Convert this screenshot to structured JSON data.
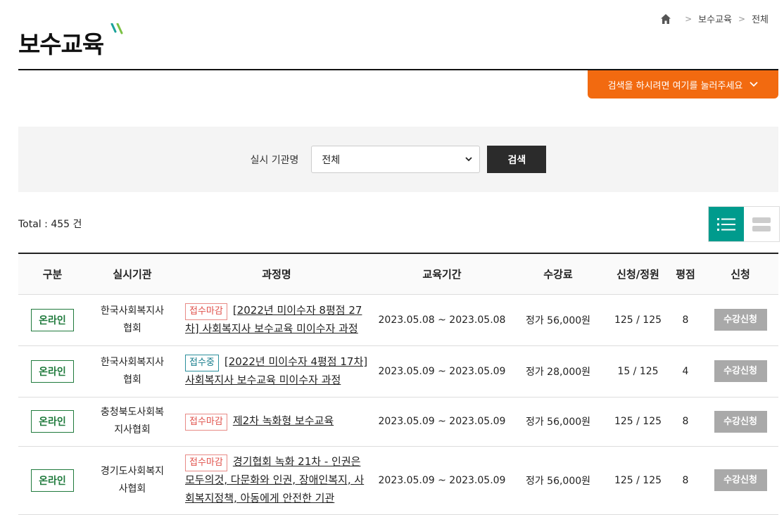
{
  "breadcrumb": {
    "items": [
      "보수교육",
      "전체"
    ]
  },
  "page_title": "보수교육",
  "search_toggle_label": "검색을 하시려면 여기를 눌러주세요",
  "search": {
    "label": "실시 기관명",
    "selected": "전체",
    "button": "검색"
  },
  "total": "Total : 455 건",
  "colors": {
    "orange": "#f26a10",
    "teal": "#009b8d",
    "green": "#1f7a3c",
    "dark": "#2b2b2b"
  },
  "table": {
    "headers": [
      "구분",
      "실시기관",
      "과정명",
      "교육기간",
      "수강료",
      "신청/정원",
      "평점",
      "신청"
    ],
    "rows": [
      {
        "type": "온라인",
        "org": [
          "한국사회복지사",
          "협회"
        ],
        "status": "접수마감",
        "course": "[2022년 미이수자 8평점 27차] 사회복지사 보수교육 미이수자 과정",
        "period": "2023.05.08 ~ 2023.05.08",
        "fee": "정가 56,000원",
        "quota": "125 / 125",
        "score": "8",
        "apply": "수강신청"
      },
      {
        "type": "온라인",
        "org": [
          "한국사회복지사",
          "협회"
        ],
        "status": "접수중",
        "course": "[2022년 미이수자 4평점 17차] 사회복지사 보수교육 미이수자 과정",
        "period": "2023.05.09 ~ 2023.05.09",
        "fee": "정가 28,000원",
        "quota": "15 / 125",
        "score": "4",
        "apply": "수강신청"
      },
      {
        "type": "온라인",
        "org": [
          "충청북도사회복",
          "지사협회"
        ],
        "status": "접수마감",
        "course": "제2차 녹화형 보수교육",
        "period": "2023.05.09 ~ 2023.05.09",
        "fee": "정가 56,000원",
        "quota": "125 / 125",
        "score": "8",
        "apply": "수강신청"
      },
      {
        "type": "온라인",
        "org": [
          "경기도사회복지",
          "사협회"
        ],
        "status": "접수마감",
        "course": "경기협회 녹화 21차 - 인권은 모두의것, 다문화와 인권, 장애인복지, 사회복지정책, 아동에게 안전한 기관",
        "period": "2023.05.09 ~ 2023.05.09",
        "fee": "정가 56,000원",
        "quota": "125 / 125",
        "score": "8",
        "apply": "수강신청"
      }
    ]
  }
}
